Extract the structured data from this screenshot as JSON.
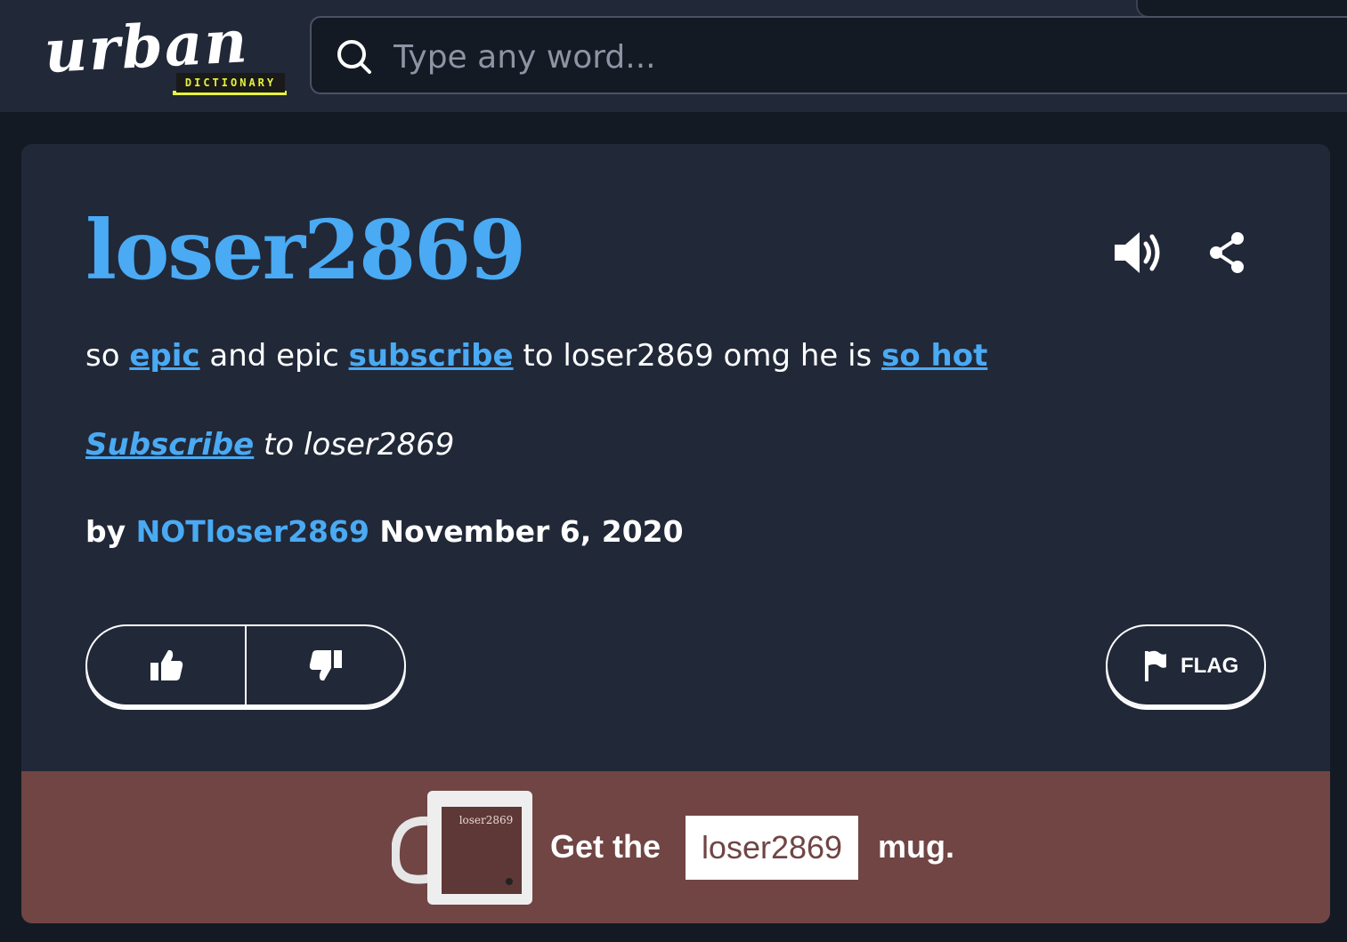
{
  "header": {
    "logo_text": "urban",
    "logo_subtext": "DICTIONARY",
    "search_placeholder": "Type any word..."
  },
  "entry": {
    "word": "loser2869",
    "meaning": {
      "t1": "so ",
      "l1": "epic",
      "t2": " and epic ",
      "l2": "subscribe",
      "t3": " to loser2869 omg he is ",
      "l3": "so hot"
    },
    "example": {
      "link": "Subscribe",
      "rest": " to loser2869"
    },
    "byline": {
      "prefix": "by ",
      "author": "NOTloser2869",
      "date": " November 6, 2020"
    },
    "flag_label": "FLAG"
  },
  "promo": {
    "mug_text": "loser2869",
    "prefix": "Get the",
    "word": "loser2869",
    "suffix": "mug."
  },
  "colors": {
    "accent": "#4aaaf3",
    "card_bg": "#212838",
    "page_bg": "#141a24",
    "promo_bg": "#704544",
    "logo_yellow": "#e7f33e"
  }
}
